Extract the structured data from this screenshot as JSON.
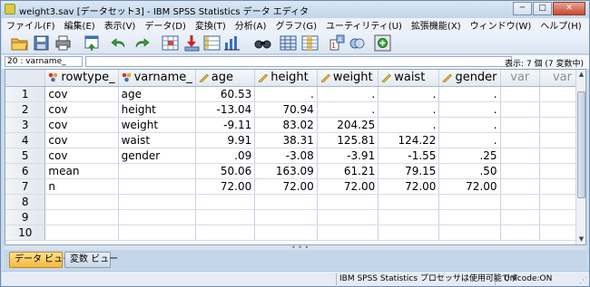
{
  "window": {
    "title": "weight3.sav [データセット3] - IBM SPSS Statistics データ エディタ",
    "minimize": "─",
    "maximize": "□",
    "close": "✕"
  },
  "menu": [
    "ファイル(F)",
    "編集(E)",
    "表示(V)",
    "データ(D)",
    "変換(T)",
    "分析(A)",
    "グラフ(G)",
    "ユーティリティ(U)",
    "拡張機能(X)",
    "ウィンドウ(W)",
    "ヘルプ(H)"
  ],
  "toolbar": {
    "icons": [
      "open-folder-icon",
      "save-icon",
      "print-icon",
      "dialog-recall-icon",
      "undo-icon",
      "redo-icon",
      "goto-case-icon",
      "goto-variable-icon",
      "variables-icon",
      "run-descriptives-icon",
      "find-icon",
      "insert-cases-icon",
      "insert-variable-icon",
      "split-file-icon",
      "weight-cases-icon",
      "value-labels-icon",
      "use-sets-icon",
      "spelling-icon"
    ]
  },
  "cell_editor": {
    "reference": "20 : varname_",
    "value": "",
    "shown": "表示: 7 個 (7 変数中)"
  },
  "grid": {
    "columns": [
      {
        "name": "rowtype_",
        "type": "string"
      },
      {
        "name": "varname_",
        "type": "string"
      },
      {
        "name": "age",
        "type": "scale"
      },
      {
        "name": "height",
        "type": "scale"
      },
      {
        "name": "weight",
        "type": "scale"
      },
      {
        "name": "waist",
        "type": "scale"
      },
      {
        "name": "gender",
        "type": "scale"
      },
      {
        "name": "var",
        "type": "empty"
      },
      {
        "name": "var",
        "type": "empty"
      }
    ],
    "rows": [
      {
        "n": "1",
        "cells": [
          "cov",
          "age",
          "60.53",
          ".",
          ".",
          ".",
          "."
        ]
      },
      {
        "n": "2",
        "cells": [
          "cov",
          "height",
          "-13.04",
          "70.94",
          ".",
          ".",
          "."
        ]
      },
      {
        "n": "3",
        "cells": [
          "cov",
          "weight",
          "-9.11",
          "83.02",
          "204.25",
          ".",
          "."
        ]
      },
      {
        "n": "4",
        "cells": [
          "cov",
          "waist",
          "9.91",
          "38.31",
          "125.81",
          "124.22",
          "."
        ]
      },
      {
        "n": "5",
        "cells": [
          "cov",
          "gender",
          ".09",
          "-3.08",
          "-3.91",
          "-1.55",
          ".25"
        ]
      },
      {
        "n": "6",
        "cells": [
          "mean",
          "",
          "50.06",
          "163.09",
          "61.21",
          "79.15",
          ".50"
        ]
      },
      {
        "n": "7",
        "cells": [
          "n",
          "",
          "72.00",
          "72.00",
          "72.00",
          "72.00",
          "72.00"
        ]
      },
      {
        "n": "8",
        "cells": [
          "",
          "",
          "",
          "",
          "",
          "",
          ""
        ]
      },
      {
        "n": "9",
        "cells": [
          "",
          "",
          "",
          "",
          "",
          "",
          ""
        ]
      },
      {
        "n": "10",
        "cells": [
          "",
          "",
          "",
          "",
          "",
          "",
          ""
        ]
      }
    ]
  },
  "tabs": {
    "data_view": "データ ビュー",
    "variable_view": "変数 ビュー"
  },
  "status": {
    "processor": "IBM SPSS Statistics プロセッサは使用可能です",
    "unicode": "Unicode:ON"
  },
  "colors": {
    "active_tab": "#f4b942",
    "window_frame": "#c9dcee",
    "grid_line": "#c9d2de"
  }
}
